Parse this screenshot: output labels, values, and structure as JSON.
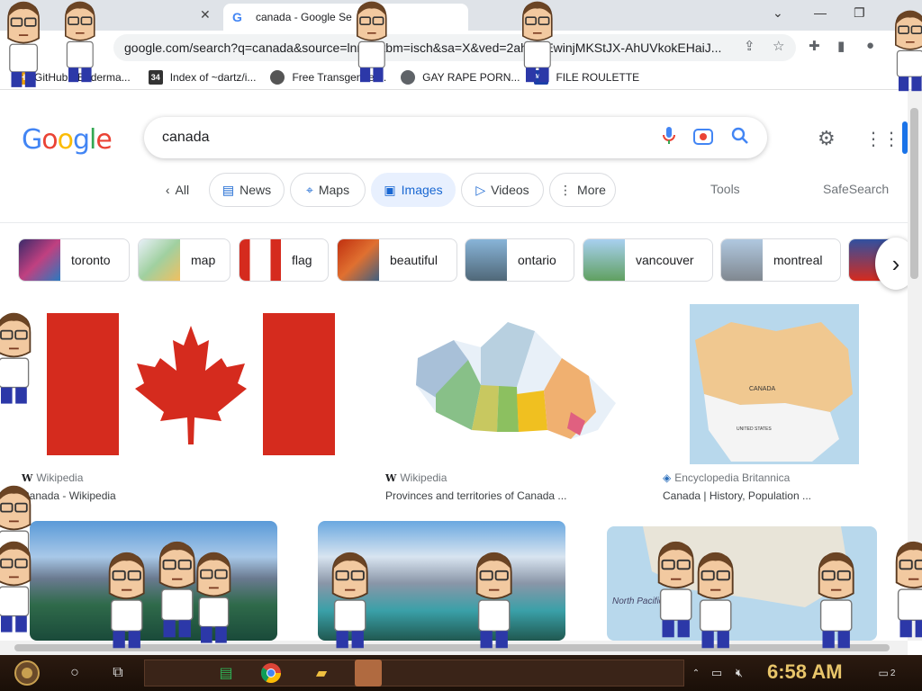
{
  "browser": {
    "tab_title": "canada - Google Se",
    "tab_icon": "google-g-icon",
    "url": "google.com/search?q=canada&source=lnms&tbm=isch&sa=X&ved=2ahUKEwinjMKStJX-AhUVkokEHaiJ..."
  },
  "bookmarks": [
    {
      "label": "GitHub - Enderma...",
      "icon": "ph-icon",
      "badge": "PH",
      "color": "#f0a000"
    },
    {
      "label": "Index of ~dartz/i...",
      "icon": "site-icon",
      "badge": "34",
      "color": "#333333"
    },
    {
      "label": "Free Transgender...",
      "icon": "site-icon",
      "badge": "",
      "color": "#555555"
    },
    {
      "label": "GAY RAPE PORN...",
      "icon": "globe-icon",
      "badge": "",
      "color": "#5f6368"
    },
    {
      "label": "FILE ROULETTE",
      "icon": "site-icon",
      "badge": "MFT",
      "color": "#1a3fa8"
    }
  ],
  "search": {
    "logo": "Google",
    "query": "canada"
  },
  "filters": {
    "all": "All",
    "news": "News",
    "maps": "Maps",
    "images": "Images",
    "videos": "Videos",
    "more": "More",
    "tools": "Tools",
    "safesearch": "SafeSearch"
  },
  "related": [
    "toronto",
    "map",
    "flag",
    "beautiful",
    "ontario",
    "vancouver",
    "montreal"
  ],
  "results": [
    {
      "source": "Wikipedia",
      "title": "Canada - Wikipedia"
    },
    {
      "source": "Wikipedia",
      "title": "Provinces and territories of Canada ..."
    },
    {
      "source": "Encyclopedia Britannica",
      "title": "Canada | History, Population ..."
    }
  ],
  "map_labels": {
    "canada": "CANADA",
    "united_states": "UNITED STATES",
    "north_pacific": "North Pacific Ocean"
  },
  "taskbar": {
    "clock": "6:58 AM",
    "notifications": "2"
  },
  "colors": {
    "accent": "#1a73e8",
    "flag_red": "#d52b1e",
    "chip_active_bg": "#e8f0fe"
  }
}
